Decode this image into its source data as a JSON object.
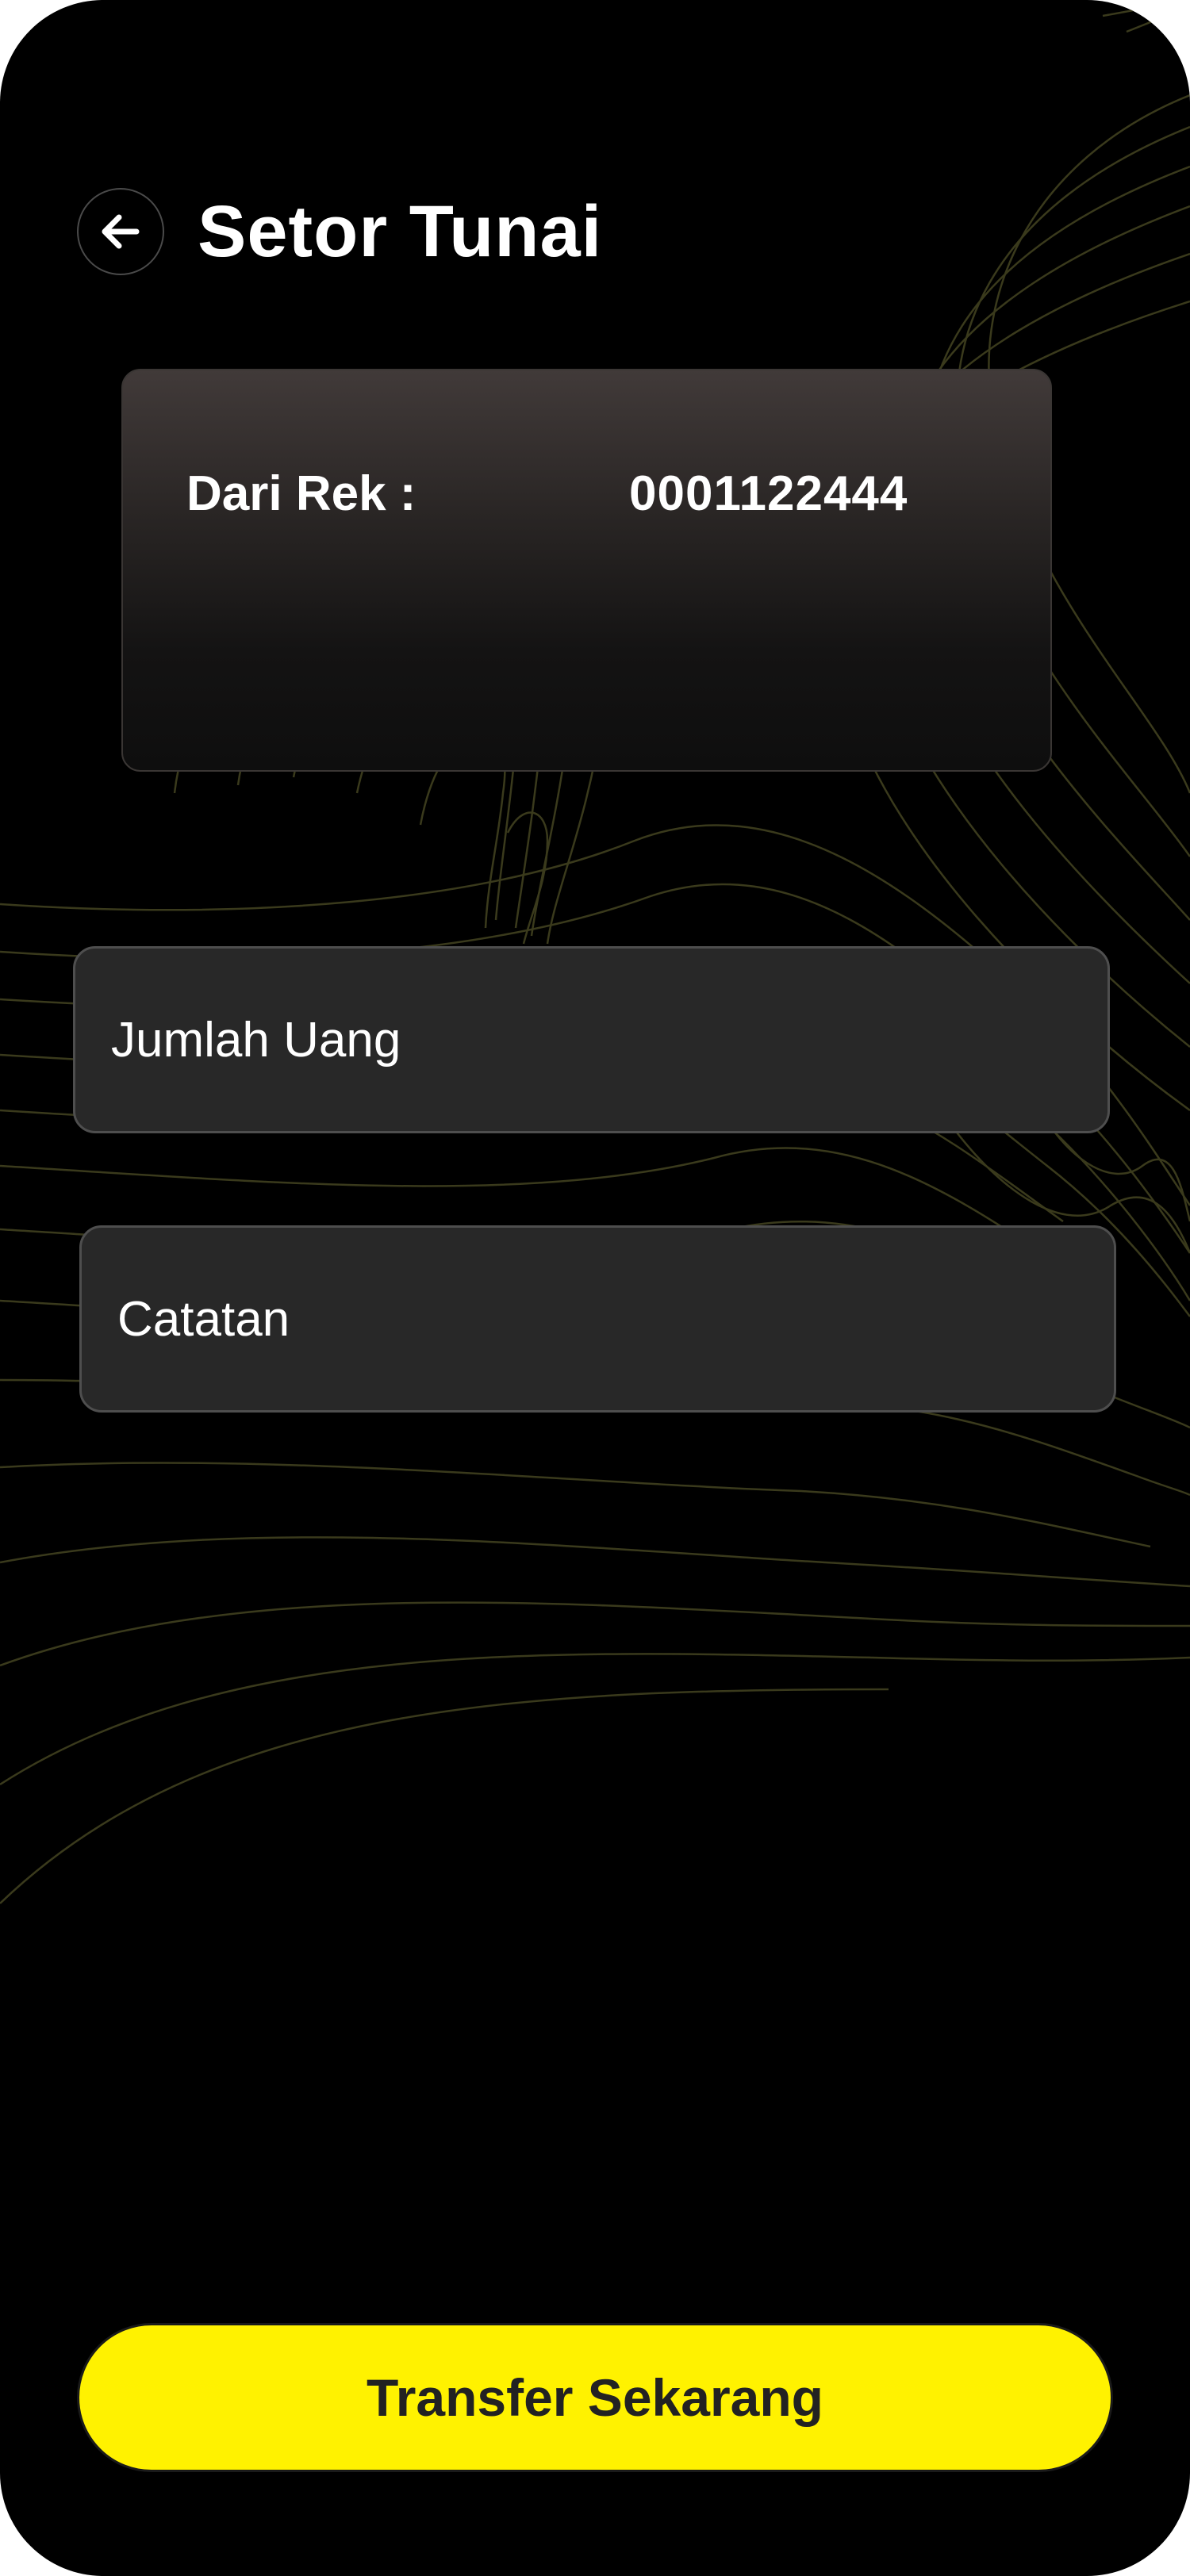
{
  "header": {
    "title": "Setor Tunai",
    "back_icon": "arrow-left-icon"
  },
  "account_card": {
    "label": "Dari Rek :",
    "account_number": "0001122444"
  },
  "form": {
    "amount": {
      "value": "",
      "placeholder": "Jumlah Uang"
    },
    "note": {
      "value": "",
      "placeholder": "Catatan"
    }
  },
  "cta": {
    "label": "Transfer Sekarang"
  },
  "colors": {
    "background": "#000000",
    "accent": "#fff200",
    "field_bg": "#282828",
    "card_top": "#413a39",
    "contour_lines": "#3a3a1c"
  }
}
